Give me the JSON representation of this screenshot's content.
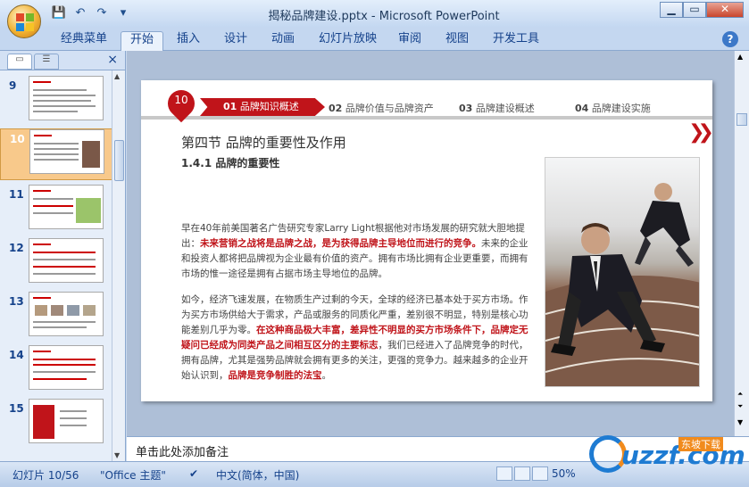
{
  "window": {
    "title": "揭秘品牌建设.pptx - Microsoft PowerPoint",
    "min": "▁",
    "max": "▭",
    "close": "✕"
  },
  "qat": [
    "💾",
    "↶",
    "↷",
    "▾"
  ],
  "ribbon_tabs": [
    {
      "label": "经典菜单"
    },
    {
      "label": "开始",
      "active": true
    },
    {
      "label": "插入"
    },
    {
      "label": "设计"
    },
    {
      "label": "动画"
    },
    {
      "label": "幻灯片放映"
    },
    {
      "label": "审阅"
    },
    {
      "label": "视图"
    },
    {
      "label": "开发工具"
    }
  ],
  "help": "?",
  "left_pane": {
    "close": "×",
    "slides": [
      "9",
      "10",
      "11",
      "12",
      "13",
      "14",
      "15"
    ],
    "selected": "10"
  },
  "slide": {
    "pin_number": "10",
    "nav": [
      {
        "num": "01",
        "label": "品牌知识概述",
        "active": true
      },
      {
        "num": "02",
        "label": "品牌价值与品牌资产"
      },
      {
        "num": "03",
        "label": "品牌建设概述"
      },
      {
        "num": "04",
        "label": "品牌建设实施"
      }
    ],
    "chevron": "❯❯",
    "section_title": "第四节  品牌的重要性及作用",
    "sub_title": "1.4.1 品牌的重要性",
    "para1": {
      "a": "早在40年前美国著名广告研究专家Larry Light根据他对市场发展的研究就大胆地提出：",
      "hl": "未来营销之战将是品牌之战，是为获得品牌主导地位而进行的竞争。",
      "b": "未来的企业和投资人都将把品牌视为企业最有价值的资产。拥有市场比拥有企业更重要，而拥有市场的惟一途径是拥有占据市场主导地位的品牌。"
    },
    "para2": {
      "a": "如今，经济飞速发展，在物质生产过剩的今天，全球的经济已基本处于买方市场。作为买方市场供给大于需求，产品或服务的同质化严重，差别很不明显，特别是核心功能差别几乎为零。",
      "hl1": "在这种商品极大丰富，差异性不明显的买方市场条件下，品牌定无疑问已经成为同类产品之间相互区分的主要标志",
      "b": "，我们已经进入了品牌竞争的时代，拥有品牌，尤其是强势品牌就会拥有更多的关注，更强的竞争力。越来越多的企业开始认识到，",
      "hl2": "品牌是竞争制胜的法宝",
      "c": "。"
    }
  },
  "notes": "单击此处添加备注",
  "status": {
    "slide": "幻灯片 10/56",
    "theme": "\"Office 主题\"",
    "lang": "中文(简体，中国)",
    "zoom": "50%"
  },
  "watermark": {
    "text": "uzzf.com",
    "badge": "东坡下载"
  }
}
